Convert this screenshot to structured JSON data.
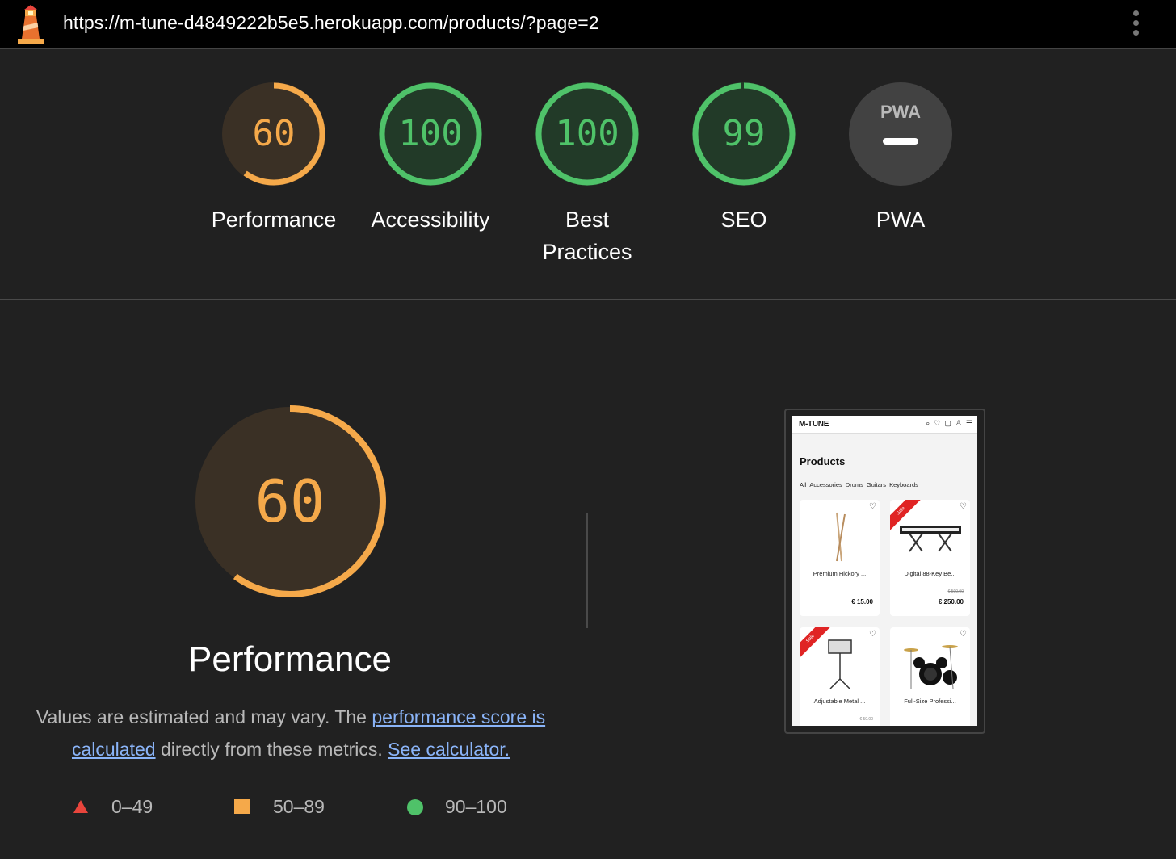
{
  "topbar": {
    "url": "https://m-tune-d4849222b5e5.herokuapp.com/products/?page=2"
  },
  "categories": [
    {
      "key": "performance",
      "label": "Performance",
      "score": 60,
      "display": "60",
      "rating": "average"
    },
    {
      "key": "accessibility",
      "label": "Accessibility",
      "score": 100,
      "display": "100",
      "rating": "pass"
    },
    {
      "key": "best_practices",
      "label": "Best Practices",
      "score": 100,
      "display": "100",
      "rating": "pass"
    },
    {
      "key": "seo",
      "label": "SEO",
      "score": 99,
      "display": "99",
      "rating": "pass"
    },
    {
      "key": "pwa",
      "label": "PWA",
      "score": null,
      "display": "",
      "rating": "na",
      "badge_text": "PWA"
    }
  ],
  "performance": {
    "score": 60,
    "display": "60",
    "title": "Performance",
    "desc_prefix": "Values are estimated and may vary. The ",
    "link_score": "performance score is calculated",
    "desc_middle": " directly from these metrics. ",
    "link_calculator": "See calculator."
  },
  "legend": [
    {
      "shape": "triangle",
      "range": "0–49",
      "color": "#e8453c"
    },
    {
      "shape": "square",
      "range": "50–89",
      "color": "#f5a94a"
    },
    {
      "shape": "circle",
      "range": "90–100",
      "color": "#4fc269"
    }
  ],
  "colors": {
    "average": "#f5a94a",
    "pass": "#4fc269",
    "fail": "#e8453c"
  },
  "thumbnail": {
    "logo": "M-TUNE",
    "title": "Products",
    "categories": [
      "All",
      "Accessories",
      "Drums",
      "Guitars",
      "Keyboards"
    ],
    "cards": [
      {
        "name": "Premium Hickory ...",
        "old_price": "",
        "price": "€ 15.00",
        "sale": false,
        "sale_label": ""
      },
      {
        "name": "Digital 88-Key Be...",
        "old_price": "€ 500.00",
        "price": "€ 250.00",
        "sale": true,
        "sale_label": "Sale"
      },
      {
        "name": "Adjustable Metal ...",
        "old_price": "€ 50.00",
        "price": "",
        "sale": true,
        "sale_label": "Sale"
      },
      {
        "name": "Full-Size Professi...",
        "old_price": "",
        "price": "",
        "sale": false,
        "sale_label": ""
      }
    ]
  }
}
